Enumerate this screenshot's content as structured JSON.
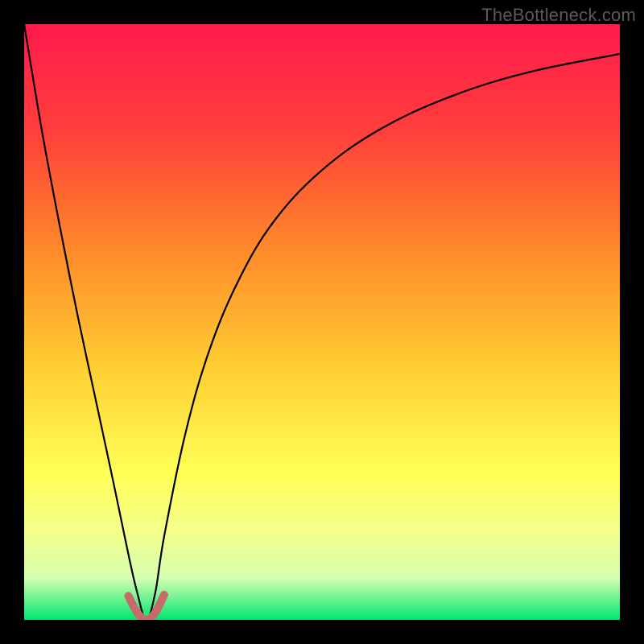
{
  "watermark": "TheBottleneck.com",
  "colors": {
    "frame": "#000000",
    "gradient_stops": [
      {
        "offset": 0.0,
        "color": "#ff1a4d"
      },
      {
        "offset": 0.18,
        "color": "#ff3f3a"
      },
      {
        "offset": 0.38,
        "color": "#ff8a2a"
      },
      {
        "offset": 0.58,
        "color": "#ffcf33"
      },
      {
        "offset": 0.75,
        "color": "#ffff55"
      },
      {
        "offset": 0.85,
        "color": "#f5ff8a"
      },
      {
        "offset": 0.93,
        "color": "#d5ffb0"
      },
      {
        "offset": 1.0,
        "color": "#00e670"
      }
    ],
    "curve": "#000000",
    "notch": "#c96a6a"
  },
  "chart_data": {
    "type": "line",
    "title": "",
    "xlabel": "",
    "ylabel": "",
    "xlim": [
      0,
      1
    ],
    "ylim": [
      0,
      1
    ],
    "notch_x": 0.205,
    "series": [
      {
        "name": "bottleneck-curve",
        "x": [
          0.0,
          0.03,
          0.06,
          0.09,
          0.12,
          0.15,
          0.175,
          0.19,
          0.205,
          0.22,
          0.235,
          0.27,
          0.31,
          0.36,
          0.42,
          0.5,
          0.6,
          0.72,
          0.85,
          1.0
        ],
        "values": [
          1.0,
          0.82,
          0.66,
          0.51,
          0.37,
          0.23,
          0.11,
          0.045,
          0.0,
          0.045,
          0.14,
          0.31,
          0.45,
          0.57,
          0.67,
          0.755,
          0.825,
          0.88,
          0.92,
          0.95
        ]
      }
    ],
    "notch_highlight": {
      "name": "notch",
      "x": [
        0.175,
        0.19,
        0.205,
        0.22,
        0.235
      ],
      "values": [
        0.04,
        0.012,
        0.0,
        0.012,
        0.042
      ]
    }
  }
}
